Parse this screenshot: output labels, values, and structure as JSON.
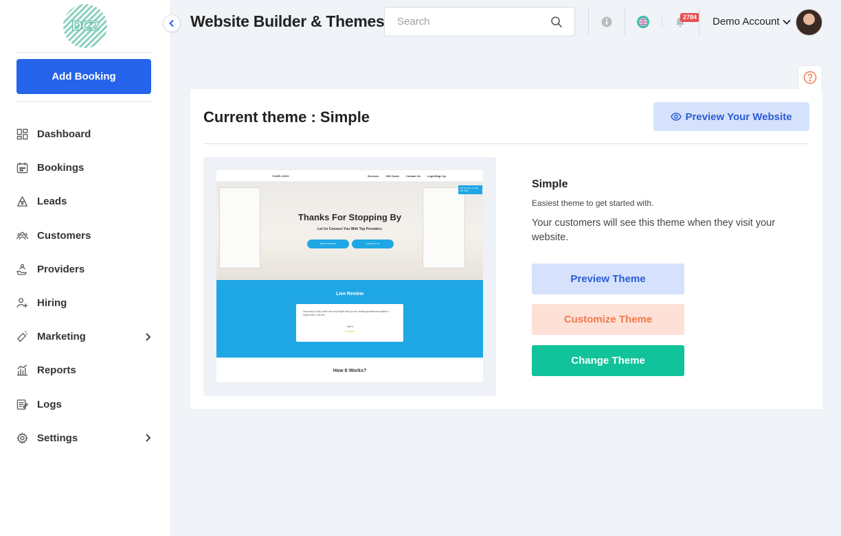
{
  "sidebar": {
    "logo_text": "DC2",
    "add_booking": "Add Booking",
    "items": [
      {
        "label": "Dashboard",
        "icon": "dashboard-icon"
      },
      {
        "label": "Bookings",
        "icon": "calendar-icon"
      },
      {
        "label": "Leads",
        "icon": "leads-icon"
      },
      {
        "label": "Customers",
        "icon": "customers-icon"
      },
      {
        "label": "Providers",
        "icon": "providers-icon"
      },
      {
        "label": "Hiring",
        "icon": "hiring-icon"
      },
      {
        "label": "Marketing",
        "icon": "megaphone-icon",
        "expandable": true
      },
      {
        "label": "Reports",
        "icon": "reports-icon"
      },
      {
        "label": "Logs",
        "icon": "logs-icon"
      },
      {
        "label": "Settings",
        "icon": "gear-icon",
        "expandable": true
      }
    ]
  },
  "header": {
    "title": "Website Builder & Themes",
    "search_placeholder": "Search",
    "notification_count": "2784",
    "account_name": "Demo Account"
  },
  "theme": {
    "current_title": "Current theme : Simple",
    "preview_website": "Preview Your Website",
    "name": "Simple",
    "tagline": "Easiest theme to get started with.",
    "description": "Your customers will see this theme when they visit your website.",
    "preview_theme": "Preview Theme",
    "customize_theme": "Customize Theme",
    "change_theme": "Change Theme",
    "thumbnail": {
      "logo": "YOUR LOGO",
      "nav_links": [
        "Services",
        "Gift Cards",
        "Contact Us",
        "Login/Sign Up"
      ],
      "cta": "Call Us Now +1 152 752 7896",
      "headline": "Thanks For Stopping By",
      "subhead": "Let Us Connect You With Top Providers",
      "btn1": "BOOK SERVICE",
      "btn2": "CONTACT US",
      "review_heading": "Live Review",
      "review_text": "Very easy to book online and very helpful that you can modify appointments anytime. I enjoyed this. Just fine.",
      "reviewer": "Yusif X",
      "stars": "★★★★★",
      "how_it_works": "How It Works?"
    }
  },
  "colors": {
    "primary": "#2563eb",
    "accent_green": "#11c39a",
    "accent_orange": "#f07a4f",
    "badge_red": "#e84e4e"
  }
}
